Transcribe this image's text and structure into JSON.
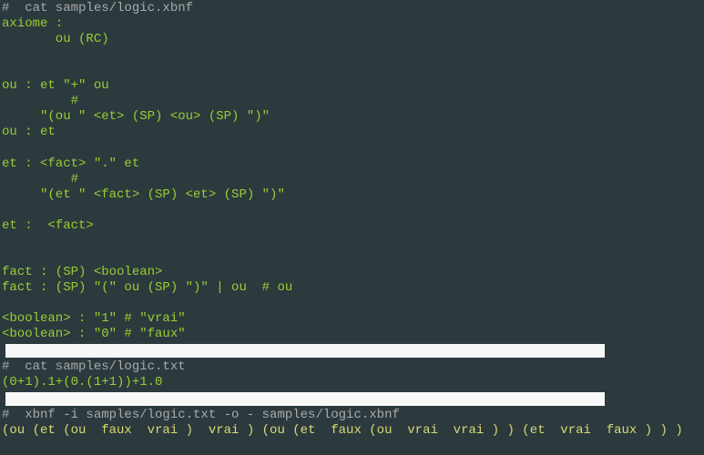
{
  "terminal": {
    "lines": [
      {
        "cls": "comment",
        "text": "#  cat samples/logic.xbnf"
      },
      {
        "cls": "green",
        "text": "axiome :"
      },
      {
        "cls": "green",
        "text": "       ou (RC)"
      },
      {
        "cls": "green",
        "text": ""
      },
      {
        "cls": "green",
        "text": ""
      },
      {
        "cls": "green",
        "text": "ou : et \"+\" ou"
      },
      {
        "cls": "green",
        "text": "         #"
      },
      {
        "cls": "green",
        "text": "     \"(ou \" <et> (SP) <ou> (SP) \")\""
      },
      {
        "cls": "green",
        "text": "ou : et"
      },
      {
        "cls": "green",
        "text": ""
      },
      {
        "cls": "green",
        "text": "et : <fact> \".\" et"
      },
      {
        "cls": "green",
        "text": "         #"
      },
      {
        "cls": "green",
        "text": "     \"(et \" <fact> (SP) <et> (SP) \")\""
      },
      {
        "cls": "green",
        "text": ""
      },
      {
        "cls": "green",
        "text": "et :  <fact>"
      },
      {
        "cls": "green",
        "text": ""
      },
      {
        "cls": "green",
        "text": ""
      },
      {
        "cls": "green",
        "text": "fact : (SP) <boolean>"
      },
      {
        "cls": "green",
        "text": "fact : (SP) \"(\" ou (SP) \")\" | ou  # ou"
      },
      {
        "cls": "green",
        "text": ""
      },
      {
        "cls": "green",
        "text": "<boolean> : \"1\" # \"vrai\""
      },
      {
        "cls": "green",
        "text": "<boolean> : \"0\" # \"faux\""
      },
      {
        "cls": "block",
        "text": ""
      },
      {
        "cls": "comment",
        "text": "#  cat samples/logic.txt"
      },
      {
        "cls": "green",
        "text": "(0+1).1+(0.(1+1))+1.0"
      },
      {
        "cls": "block",
        "text": ""
      },
      {
        "cls": "comment",
        "text": "#  xbnf -i samples/logic.txt -o - samples/logic.xbnf"
      },
      {
        "cls": "yellow",
        "text": "(ou (et (ou  faux  vrai )  vrai ) (ou (et  faux (ou  vrai  vrai ) ) (et  vrai  faux ) ) )"
      }
    ]
  }
}
